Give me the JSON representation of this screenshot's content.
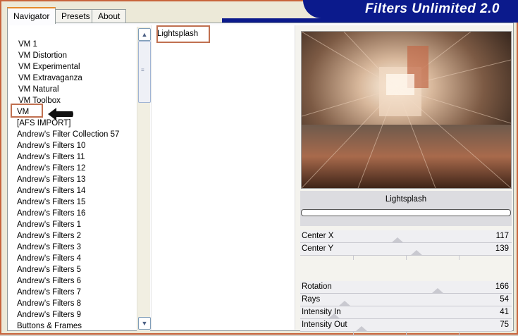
{
  "tabs": [
    {
      "label": "Navigator",
      "active": true
    },
    {
      "label": "Presets",
      "active": false
    },
    {
      "label": "About",
      "active": false
    }
  ],
  "app_title": "Filters Unlimited 2.0",
  "categories": [
    "VM 1",
    "VM Distortion",
    "VM Experimental",
    "VM Extravaganza",
    "VM Natural",
    "VM Toolbox",
    "VM",
    "[AFS IMPORT]",
    "Andrew's Filter Collection 57",
    "Andrew's Filters 10",
    "Andrew's Filters 11",
    "Andrew's Filters 12",
    "Andrew's Filters 13",
    "Andrew's Filters 14",
    "Andrew's Filters 15",
    "Andrew's Filters 16",
    "Andrew's Filters 1",
    "Andrew's Filters 2",
    "Andrew's Filters 3",
    "Andrew's Filters 4",
    "Andrew's Filters 5",
    "Andrew's Filters 6",
    "Andrew's Filters 7",
    "Andrew's Filters 8",
    "Andrew's Filters 9",
    "Buttons & Frames"
  ],
  "selected_category": "VM",
  "filters": [
    "Lightsplash"
  ],
  "filter_name": "Lightsplash",
  "params": [
    {
      "name": "Center X",
      "value": "117",
      "level": 0.46
    },
    {
      "name": "Center Y",
      "value": "139",
      "level": 0.55
    },
    {
      "name": "Rotation",
      "value": "166",
      "level": 0.65
    },
    {
      "name": "Rays",
      "value": "54",
      "level": 0.21
    },
    {
      "name": "Intensity In",
      "value": "41",
      "level": 0.16
    },
    {
      "name": "Intensity Out",
      "value": "75",
      "level": 0.29
    }
  ],
  "colors": {
    "banner": "#0b1a8c",
    "frame": "#c8643c",
    "highlight": "#c07050"
  }
}
